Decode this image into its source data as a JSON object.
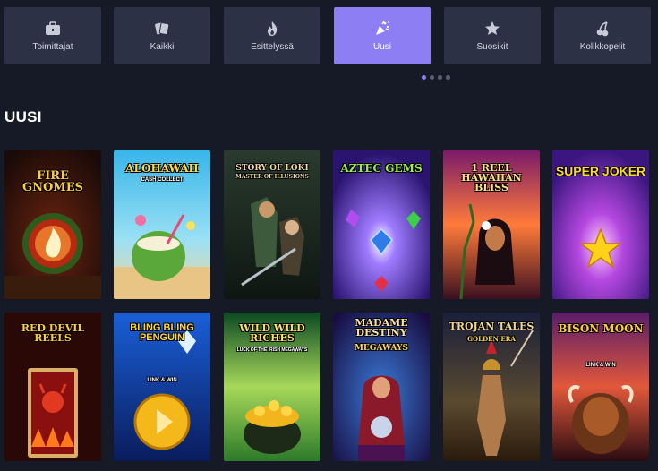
{
  "categories": [
    {
      "label": "Toimittajat",
      "icon": "briefcase-icon",
      "active": false
    },
    {
      "label": "Kaikki",
      "icon": "cards-icon",
      "active": false
    },
    {
      "label": "Esittelyssä",
      "icon": "flame-icon",
      "active": false
    },
    {
      "label": "Uusi",
      "icon": "confetti-icon",
      "active": true
    },
    {
      "label": "Suosikit",
      "icon": "star-icon",
      "active": false
    },
    {
      "label": "Kolikkopelit",
      "icon": "cherry-icon",
      "active": false
    }
  ],
  "pager": {
    "pages": 4,
    "current": 1
  },
  "section": {
    "title": "UUSI"
  },
  "games": [
    {
      "title": "FIRE GNOMES",
      "subtitle": "",
      "theme": "fire"
    },
    {
      "title": "ALOHAWAII",
      "subtitle": "CASH COLLECT",
      "theme": "beach"
    },
    {
      "title": "STORY OF LOKI",
      "subtitle": "MASTER OF ILLUSIONS",
      "theme": "loki"
    },
    {
      "title": "AZTEC GEMS",
      "subtitle": "",
      "theme": "gems"
    },
    {
      "title": "1 REEL HAWAIIAN BLISS",
      "subtitle": "",
      "theme": "hawaii"
    },
    {
      "title": "SUPER JOKER",
      "subtitle": "",
      "theme": "joker"
    },
    {
      "title": "RED DEVIL REELS",
      "subtitle": "",
      "theme": "devil"
    },
    {
      "title": "BLING BLING PENGUIN",
      "subtitle": "LINK & WIN",
      "theme": "penguin"
    },
    {
      "title": "WILD WILD RICHES",
      "subtitle": "LUCK OF THE IRISH MEGAWAYS",
      "theme": "irish"
    },
    {
      "title": "MADAME DESTINY",
      "subtitle": "MEGAWAYS",
      "theme": "destiny"
    },
    {
      "title": "TROJAN TALES",
      "subtitle": "GOLDEN ERA",
      "theme": "trojan"
    },
    {
      "title": "BISON MOON",
      "subtitle": "LINK & WIN",
      "theme": "bison"
    }
  ],
  "colors": {
    "accent": "#8d7ff3",
    "tab_bg": "#2d3145",
    "page_bg": "#161a26"
  }
}
